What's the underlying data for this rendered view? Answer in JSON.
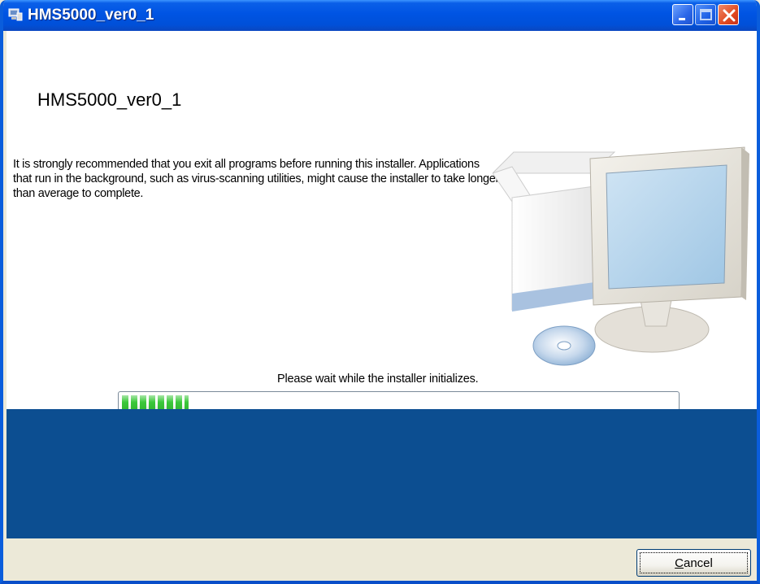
{
  "window": {
    "title": "HMS5000_ver0_1"
  },
  "titlebar_buttons": {
    "minimize": "minimize-icon",
    "maximize": "maximize-icon",
    "close": "close-icon"
  },
  "main": {
    "heading": "HMS5000_ver0_1",
    "body_text": "It is strongly recommended that you exit all programs before running this installer. Applications that run in the background, such as virus-scanning utilities, might cause the installer to take longer than average to complete.",
    "illustration": "computer-box-disc-icon",
    "status_text": "Please wait while the installer initializes.",
    "progress": 0.12
  },
  "footer": {
    "cancel_label_accel": "C",
    "cancel_label_rest": "ancel"
  },
  "colors": {
    "titlebar": "#0054e3",
    "band": "#0c4e91",
    "progress": "#3ac83a",
    "chrome": "#ece9d8"
  }
}
